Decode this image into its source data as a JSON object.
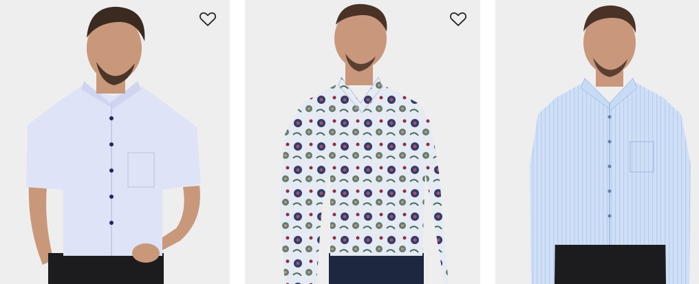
{
  "colors": {
    "background": "#ffffff",
    "photo_background": "#eeeeee",
    "heart_outline": "#222222"
  },
  "products": [
    {
      "image_description": "model-in-light-blue-short-sleeve-shirt",
      "wishlist_icon": "heart-outline-icon",
      "show_wishlist": true
    },
    {
      "image_description": "model-in-floral-print-long-sleeve-shirt",
      "wishlist_icon": "heart-outline-icon",
      "show_wishlist": true
    },
    {
      "image_description": "model-in-light-blue-striped-long-sleeve-shirt",
      "wishlist_icon": "heart-outline-icon",
      "show_wishlist": false
    }
  ]
}
